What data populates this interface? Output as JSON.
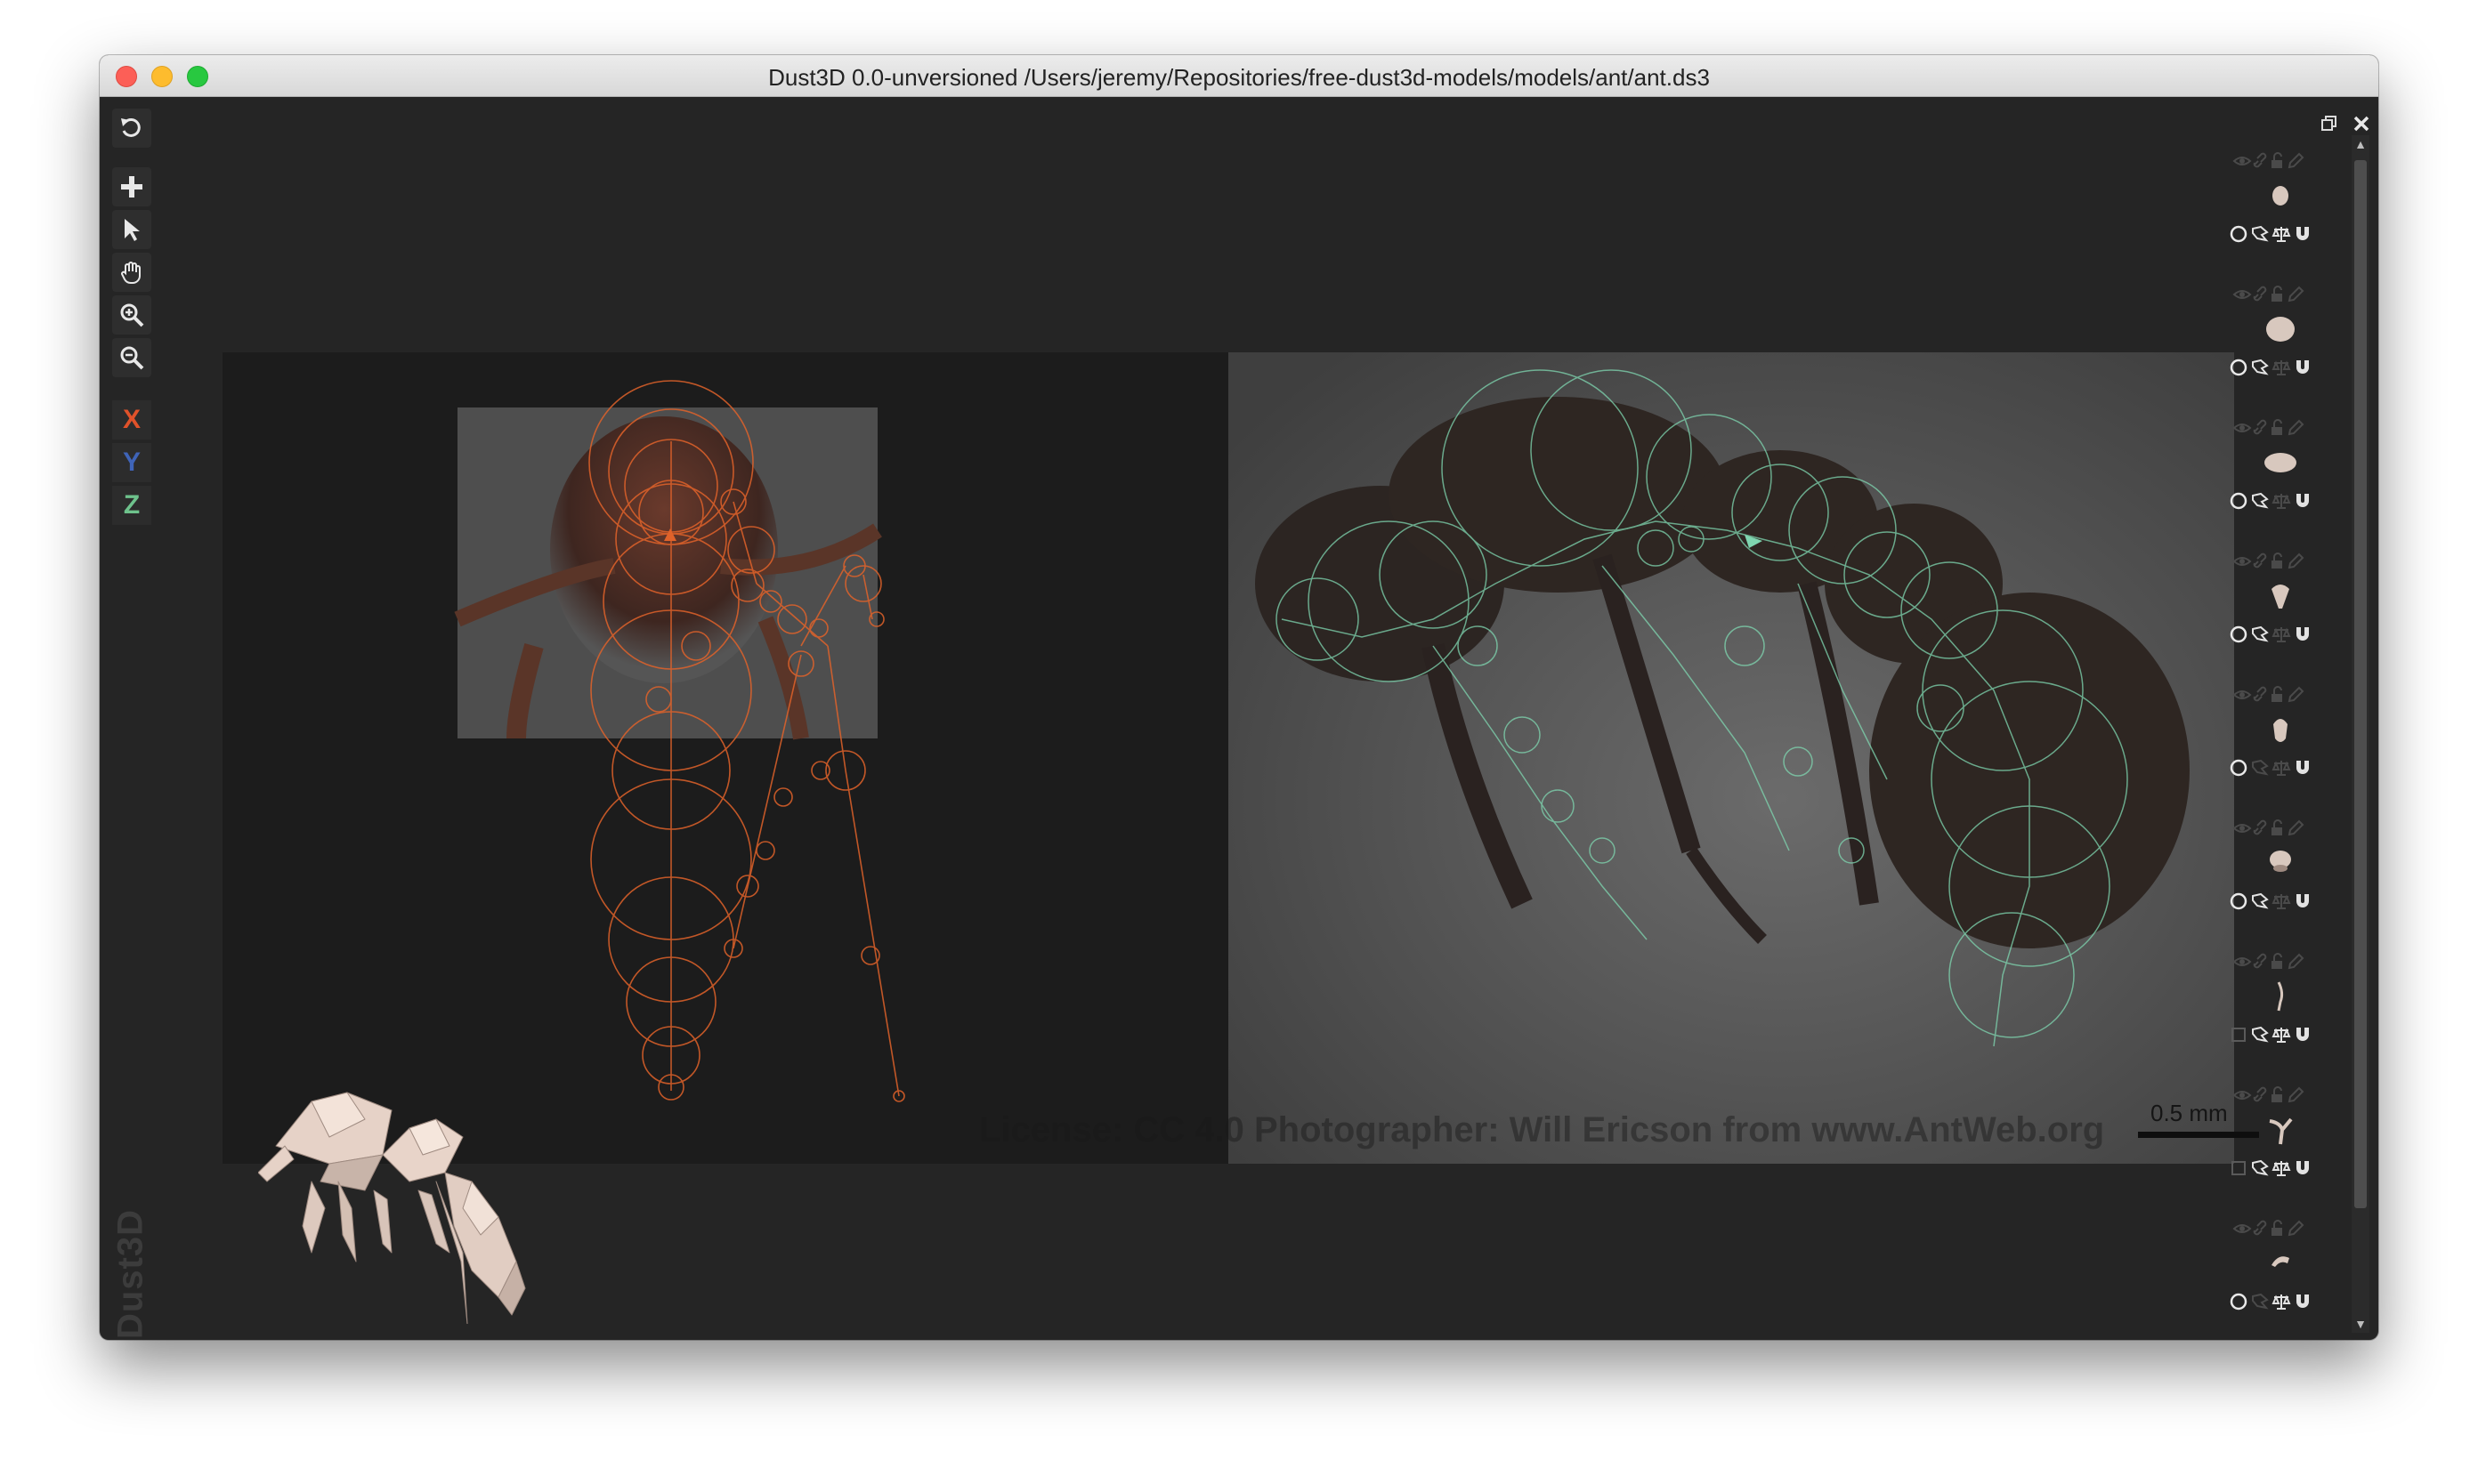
{
  "window": {
    "title": "Dust3D 0.0-unversioned /Users/jeremy/Repositories/free-dust3d-models/models/ant/ant.ds3"
  },
  "toolbar": {
    "tools": [
      "undo-icon",
      "add-icon",
      "select-arrow-icon",
      "pan-hand-icon",
      "zoom-in-icon",
      "zoom-out-icon"
    ],
    "axes": [
      {
        "label": "X",
        "color": "#e0522a"
      },
      {
        "label": "Y",
        "color": "#3f64b8"
      },
      {
        "label": "Z",
        "color": "#6ec28c"
      }
    ]
  },
  "brand": {
    "label": "Dust3D"
  },
  "canvas": {
    "license": "License: CC 4.0 Photographer: Will Ericson from www.AntWeb.org",
    "scale_label": "0.5 mm",
    "front_view_color": "#e0622a",
    "side_view_color": "#7fd6b0"
  },
  "parts_panel": {
    "header_icons": [
      "restore-window-icon",
      "close-panel-icon"
    ],
    "row_top_icons": [
      "eye-icon",
      "link-icon",
      "lock-icon",
      "pencil-icon"
    ],
    "row_bottom_icons": [
      "radio-icon",
      "subdivide-icon",
      "mirror-balance-icon",
      "magnet-icon"
    ],
    "parts": [
      {
        "shape": "head",
        "color": "#d8c8be",
        "enabled": true,
        "mirror": true,
        "radio": "circle"
      },
      {
        "shape": "thorax",
        "color": "#d8c8be",
        "enabled": true,
        "mirror": false,
        "radio": "circle"
      },
      {
        "shape": "petiole",
        "color": "#d8c8be",
        "enabled": true,
        "mirror": false,
        "radio": "circle"
      },
      {
        "shape": "cone",
        "color": "#d8c8be",
        "enabled": true,
        "mirror": false,
        "radio": "circle"
      },
      {
        "shape": "abdomen",
        "color": "#d8c8be",
        "enabled": false,
        "mirror": false,
        "radio": "circle"
      },
      {
        "shape": "node",
        "color": "#d8c8be",
        "enabled": true,
        "mirror": false,
        "radio": "circle"
      },
      {
        "shape": "antenna",
        "color": "#d8c8be",
        "enabled": true,
        "mirror": true,
        "radio": "square"
      },
      {
        "shape": "leg",
        "color": "#d8c8be",
        "enabled": true,
        "mirror": true,
        "radio": "square"
      },
      {
        "shape": "mandible",
        "color": "#d8c8be",
        "enabled": false,
        "mirror": true,
        "radio": "circle"
      }
    ]
  }
}
